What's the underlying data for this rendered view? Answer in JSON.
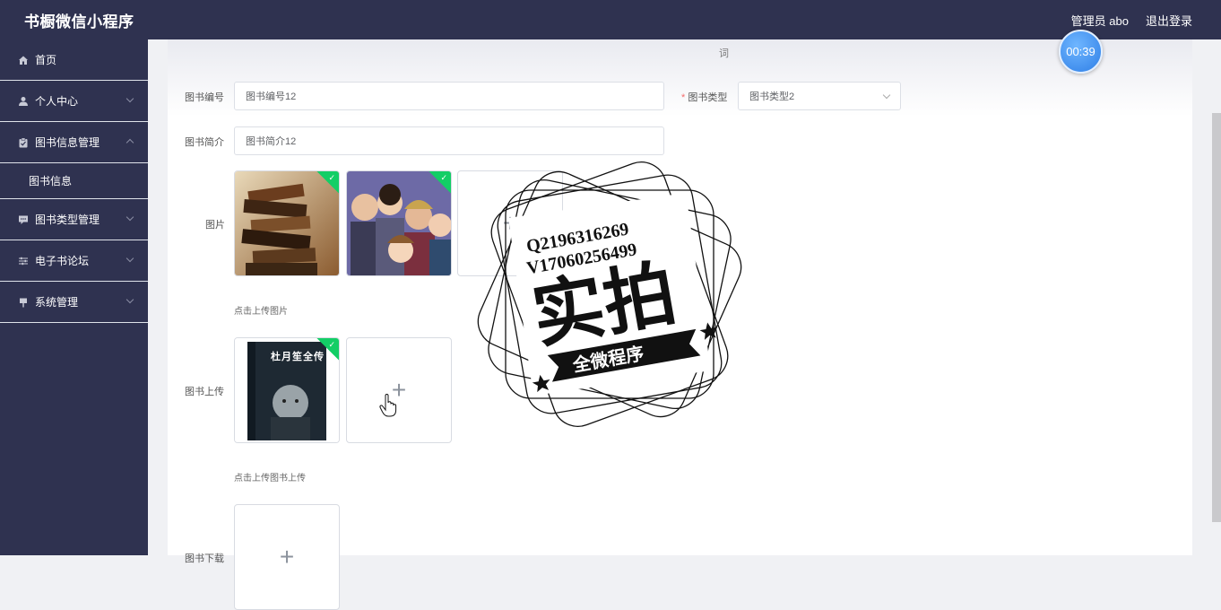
{
  "app": {
    "title": "书橱微信小程序",
    "admin_label": "管理员 abo",
    "logout": "退出登录"
  },
  "timer": "00:39",
  "sidebar": {
    "items": [
      {
        "label": "首页",
        "icon": "home-icon"
      },
      {
        "label": "个人中心",
        "icon": "user-icon"
      },
      {
        "label": "图书信息管理",
        "icon": "clipboard-icon"
      },
      {
        "label": "图书信息",
        "icon": ""
      },
      {
        "label": "图书类型管理",
        "icon": "chat-icon"
      },
      {
        "label": "电子书论坛",
        "icon": "sliders-icon"
      },
      {
        "label": "系统管理",
        "icon": "flag-icon"
      }
    ]
  },
  "header": {
    "text": "词"
  },
  "form": {
    "book_no_label": "图书编号",
    "book_no_value": "图书编号12",
    "book_type_required": "*",
    "book_type_label": "图书类型",
    "book_type_value": "图书类型2",
    "intro_label": "图书简介",
    "intro_value": "图书简介12",
    "image_label": "图片",
    "image_hint": "点击上传图片",
    "upload_label": "图书上传",
    "upload_hint": "点击上传图书上传",
    "download_label": "图书下载",
    "plus": "+",
    "check": "✓"
  },
  "thumbs": {
    "book_cover_title": "杜月笙全传"
  },
  "watermark": {
    "line1": "Q2196316269",
    "line2": "V17060256499",
    "big": "实拍",
    "banner": "全微程序"
  },
  "colors": {
    "nav_bg": "#2f3250",
    "accent_check": "#13ce66",
    "timer": "#2f7fe6"
  }
}
